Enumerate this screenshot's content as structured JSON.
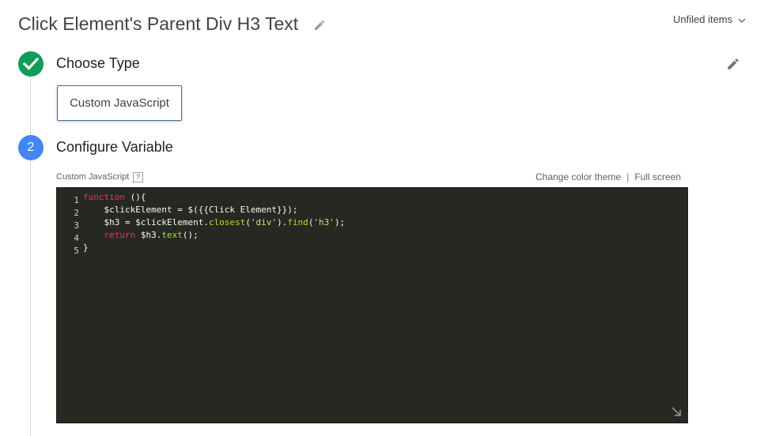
{
  "header": {
    "title": "Click Element's Parent Div H3 Text",
    "folder_label": "Unfiled items",
    "icons": {
      "title_edit": "pencil-icon",
      "folder_dropdown": "chevron-down-icon"
    }
  },
  "steps": [
    {
      "title": "Choose Type",
      "status": "complete",
      "icon": "check-icon",
      "selected_type": "Custom JavaScript",
      "edit_icon": "pencil-icon"
    },
    {
      "title": "Configure Variable",
      "number": "2",
      "field_label": "Custom JavaScript",
      "help_label": "?",
      "links": {
        "theme": "Change color theme",
        "separator": "|",
        "fullscreen": "Full screen"
      },
      "editor": {
        "line_numbers": [
          "1",
          "2",
          "3",
          "4",
          "5"
        ],
        "lines": [
          [
            {
              "t": "function",
              "c": "kw"
            },
            {
              "t": " (){",
              "c": ""
            }
          ],
          [
            {
              "t": "    $clickElement = $({{Click Element}});",
              "c": ""
            }
          ],
          [
            {
              "t": "    $h3 = $clickElement.",
              "c": ""
            },
            {
              "t": "closest",
              "c": "fn"
            },
            {
              "t": "(",
              "c": ""
            },
            {
              "t": "'div'",
              "c": "str"
            },
            {
              "t": ").",
              "c": ""
            },
            {
              "t": "find",
              "c": "fn"
            },
            {
              "t": "(",
              "c": ""
            },
            {
              "t": "'h3'",
              "c": "str"
            },
            {
              "t": ");",
              "c": ""
            }
          ],
          [
            {
              "t": "    ",
              "c": ""
            },
            {
              "t": "return",
              "c": "kw"
            },
            {
              "t": " $h3.",
              "c": ""
            },
            {
              "t": "text",
              "c": "fn"
            },
            {
              "t": "();",
              "c": ""
            }
          ],
          [
            {
              "t": "}",
              "c": ""
            }
          ]
        ],
        "resize_icon": "resize-corner-icon"
      }
    }
  ],
  "colors": {
    "complete_green": "#0f9d58",
    "step_blue": "#4285f4",
    "editor_bg": "#272822",
    "keyword": "#f92672",
    "function": "#a6e22e",
    "string": "#e6db74"
  }
}
